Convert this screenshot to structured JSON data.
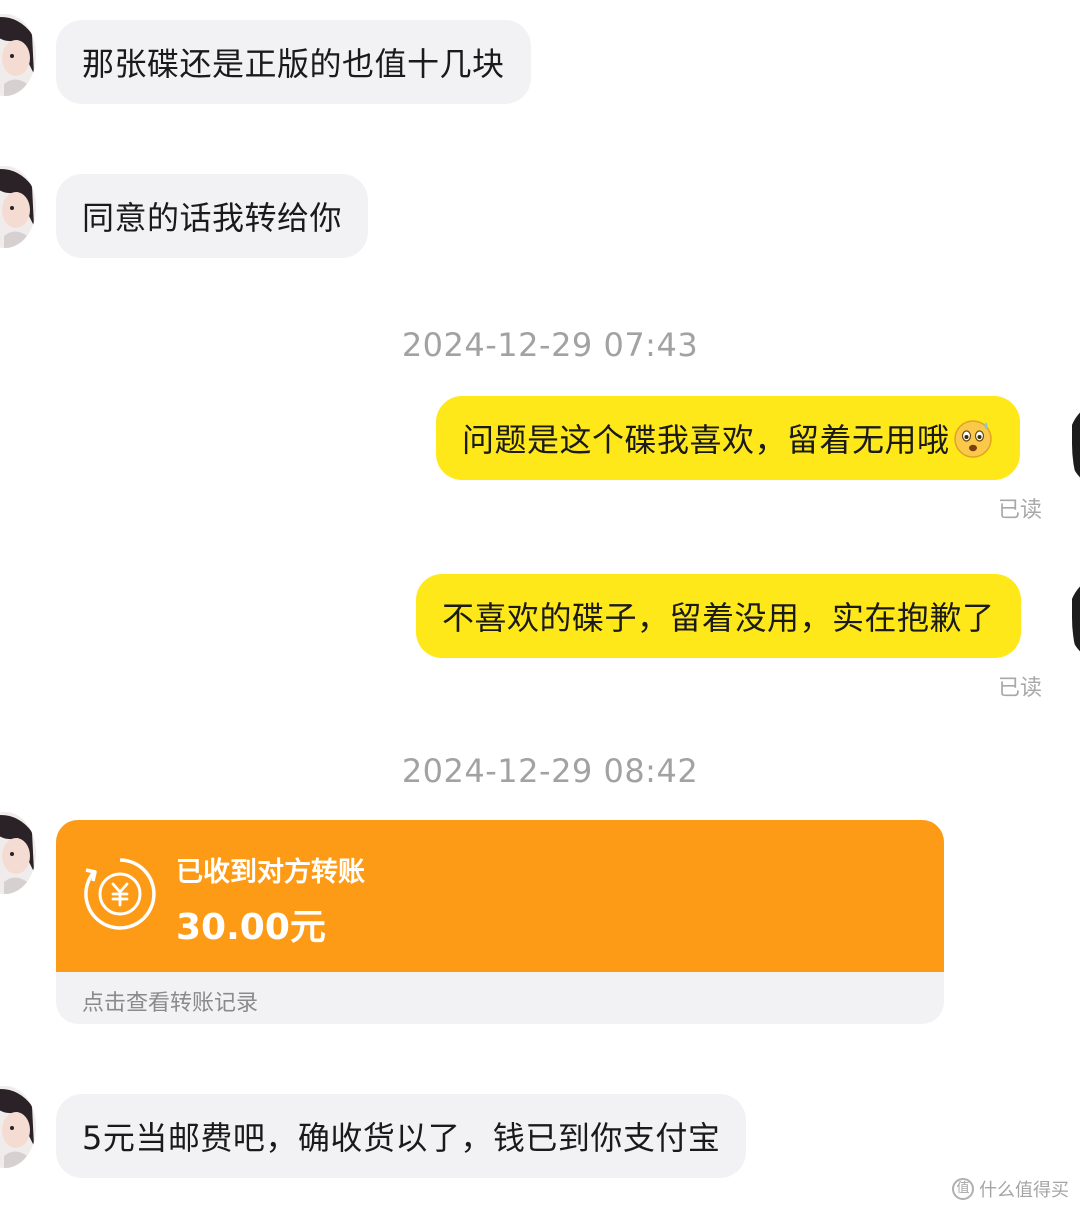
{
  "messages": [
    {
      "side": "left",
      "text": "那张碟还是正版的也值十几块"
    },
    {
      "side": "left",
      "text": "同意的话我转给你"
    },
    {
      "side": "right",
      "text": "问题是这个碟我喜欢，留着无用哦",
      "emoji": "sweating-smile-emoji",
      "status": "已读"
    },
    {
      "side": "right",
      "text": "不喜欢的碟子，留着没用，实在抱歉了",
      "status": "已读"
    },
    {
      "side": "left",
      "text": "5元当邮费吧，确收货以了，钱已到你支付宝"
    }
  ],
  "timestamps": [
    "2024-12-29 07:43",
    "2024-12-29 08:42"
  ],
  "transfer": {
    "title": "已收到对方转账",
    "amount": "30.00元",
    "footer": "点击查看转账记录",
    "icon": "currency-exchange-icon",
    "color": "#fd9b17"
  },
  "watermark": {
    "icon": "zhi-logo-icon",
    "text": "什么值得买"
  },
  "colors": {
    "incoming_bubble": "#f2f2f4",
    "outgoing_bubble": "#ffe81a",
    "timestamp": "#a2a2a2"
  }
}
